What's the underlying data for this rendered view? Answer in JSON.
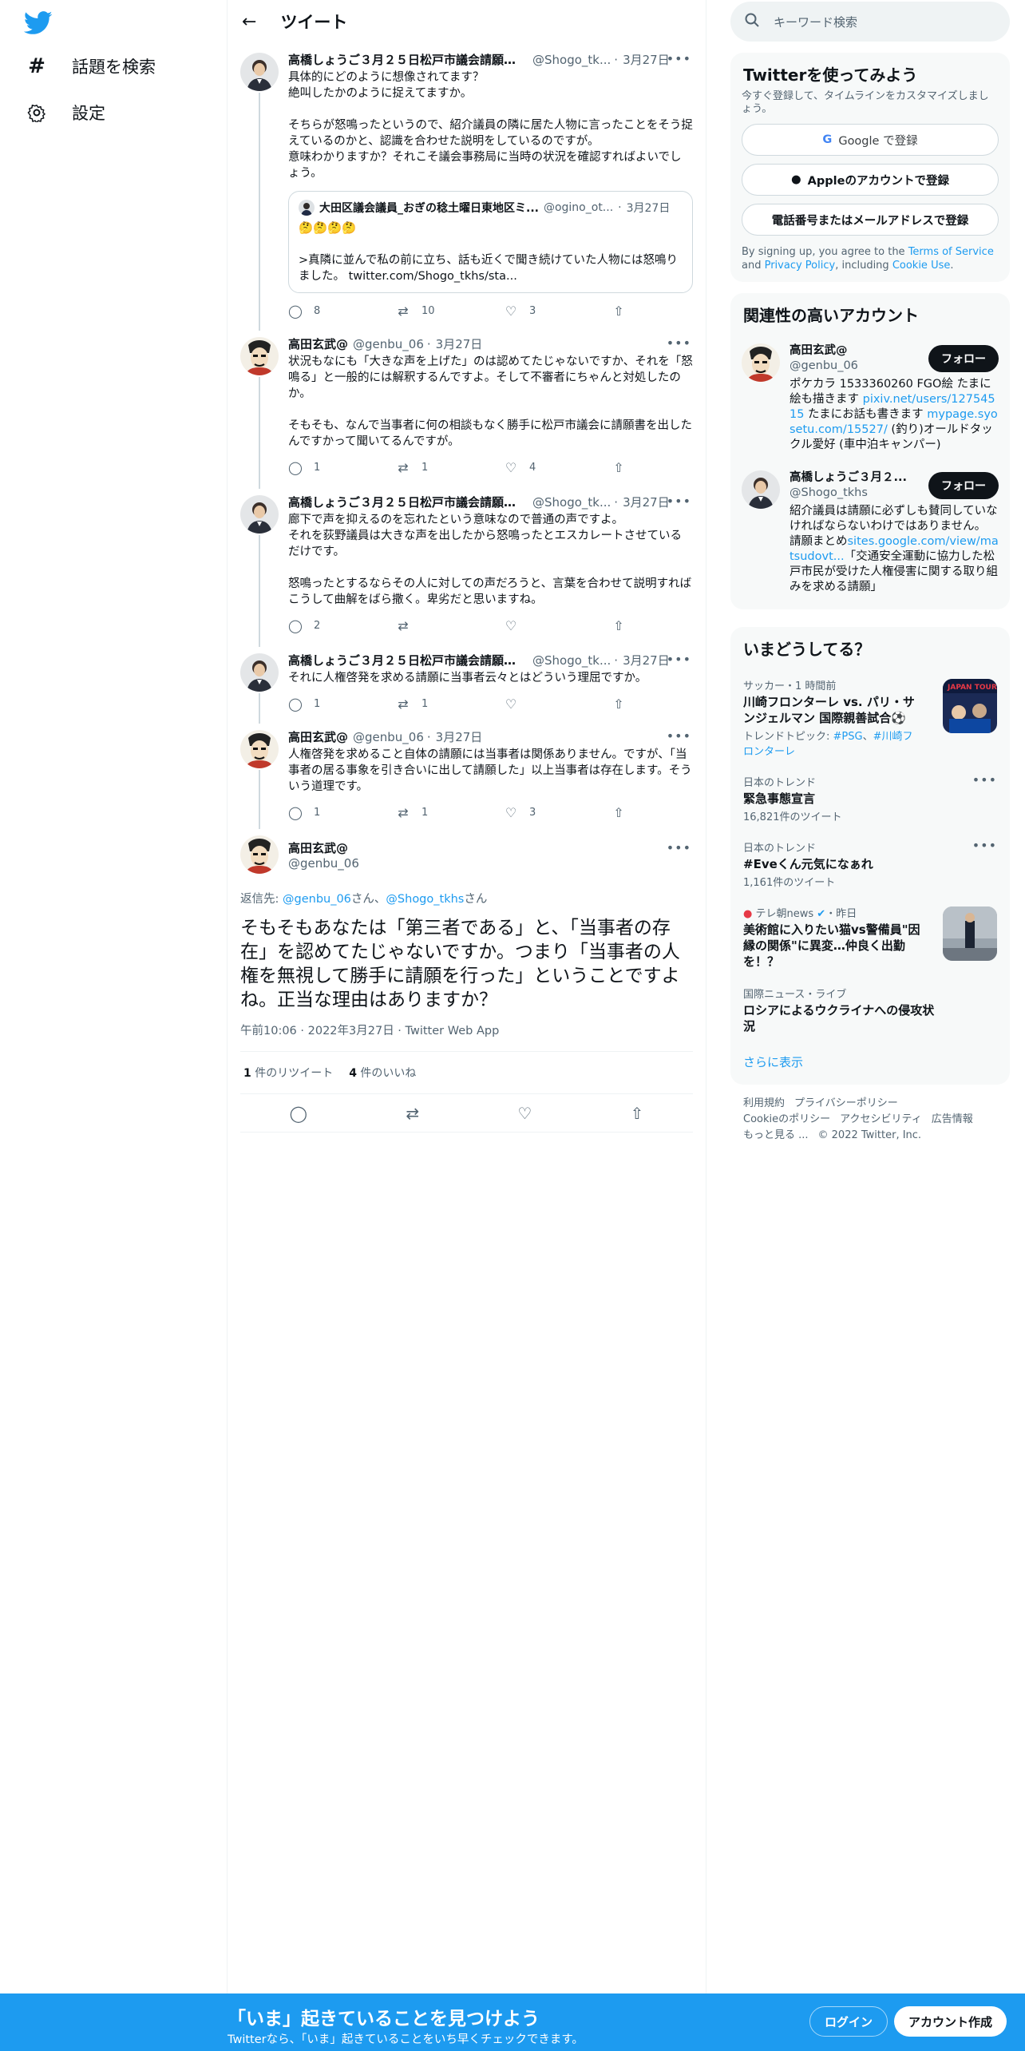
{
  "nav": {
    "items": [
      {
        "label": "話題を検索",
        "icon": "hashtag-icon"
      },
      {
        "label": "設定",
        "icon": "gear-icon"
      }
    ]
  },
  "header": {
    "title": "ツイート"
  },
  "thread": [
    {
      "name": "高橋しょうご３月２５日松戸市議会請願審...",
      "handle": "@Shogo_tk...",
      "date": "3月27日",
      "text": "具体的にどのように想像されてます？\n絶叫したかのように捉えてますか。\n\nそちらが怒鳴ったというので、紹介議員の隣に居た人物に言ったことをそう捉えているのかと、認識を合わせた説明をしているのですが。\n意味わかりますか？それこそ議会事務局に当時の状況を確認すればよいでしょう。",
      "quote": {
        "name": "大田区議会議員_おぎの稔土曜日東地区ミ...",
        "handle": "@ogino_ot...",
        "date": "3月27日",
        "text": "🤔🤔🤔🤔\n\n>真隣に並んで私の前に立ち、話も近くで聞き続けていた人物には怒鳴りました。 twitter.com/Shogo_tkhs/sta..."
      },
      "replies": "8",
      "retweets": "10",
      "likes": "3"
    },
    {
      "name": "高田玄武@",
      "handle": "@genbu_06",
      "date": "3月27日",
      "text": "状況もなにも「大きな声を上げた」のは認めてたじゃないですか、それを「怒鳴る」と一般的には解釈するんですよ。そして不審者にちゃんと対処したのか。\n\nそもそも、なんで当事者に何の相談もなく勝手に松戸市議会に請願書を出したんですかって聞いてるんですが。",
      "replies": "1",
      "retweets": "1",
      "likes": "4"
    },
    {
      "name": "高橋しょうご３月２５日松戸市議会請願審...",
      "handle": "@Shogo_tk...",
      "date": "3月27日",
      "text": "廊下で声を抑えるのを忘れたという意味なので普通の声ですよ。\nそれを荻野議員は大きな声を出したから怒鳴ったとエスカレートさせているだけです。\n\n怒鳴ったとするならその人に対しての声だろうと、言葉を合わせて説明すればこうして曲解をばら撒く。卑劣だと思いますね。",
      "replies": "2",
      "retweets": "",
      "likes": ""
    },
    {
      "name": "高橋しょうご３月２５日松戸市議会請願審...",
      "handle": "@Shogo_tk...",
      "date": "3月27日",
      "text": "それに人権啓発を求める請願に当事者云々とはどういう理屈ですか。",
      "replies": "1",
      "retweets": "1",
      "likes": ""
    },
    {
      "name": "高田玄武@",
      "handle": "@genbu_06",
      "date": "3月27日",
      "text": "人権啓発を求めること自体の請願には当事者は関係ありません。ですが、「当事者の居る事象を引き合いに出して請願した」以上当事者は存在します。そういう道理です。",
      "replies": "1",
      "retweets": "1",
      "likes": "3"
    }
  ],
  "focus": {
    "name": "高田玄武@",
    "handle": "@genbu_06",
    "replying_prefix": "返信先: ",
    "mention1": "@genbu_06",
    "san1": "さん、",
    "mention2": "@Shogo_tkhs",
    "san2": "さん",
    "text": "そもそもあなたは「第三者である」と、「当事者の存在」を認めてたじゃないですか。つまり「当事者の人権を無視して勝手に請願を行った」ということですよね。正当な理由はありますか？",
    "time": "午前10:06",
    "date": "2022年3月27日",
    "client": "Twitter Web App",
    "retweets_count": "1",
    "retweets_label": "件のリツイート",
    "likes_count": "4",
    "likes_label": "件のいいね"
  },
  "search": {
    "placeholder": "キーワード検索"
  },
  "signup": {
    "title": "Twitterを使ってみよう",
    "subtitle": "今すぐ登録して、タイムラインをカスタマイズしましょう。",
    "google": "Google で登録",
    "apple": "Appleのアカウントで登録",
    "phone": "電話番号またはメールアドレスで登録",
    "terms_prefix": "By signing up, you agree to the ",
    "terms_link": "Terms of Service",
    "terms_and": " and ",
    "privacy_link": "Privacy Policy",
    "terms_including": ", including ",
    "cookie_link": "Cookie Use",
    "terms_end": "."
  },
  "related": {
    "title": "関連性の高いアカウント",
    "follow_label": "フォロー",
    "accounts": [
      {
        "name": "高田玄武@",
        "handle": "@genbu_06",
        "bio1": "ポケカラ 1533360260 FGO絵 たまに絵も描きます ",
        "link1": "pixiv.net/users/12754515",
        "bio2": " たまにお話も書きます ",
        "link2": "mypage.syosetu.com/15527/",
        "bio3": " (釣り)オールドタックル愛好 (車中泊キャンパー)"
      },
      {
        "name": "高橋しょうご３月２...",
        "handle": "@Shogo_tkhs",
        "bio1": "紹介議員は請願に必ずしも賛同していなければならないわけではありません。　 請願まとめ",
        "link1": "sites.google.com/view/matsudovt...",
        "bio2": "「交通安全運動に協力した松戸市民が受けた人権侵害に関する取り組みを求める請願」"
      }
    ]
  },
  "trends": {
    "title": "いまどうしてる？",
    "items": [
      {
        "context": "サッカー・1 時間前",
        "title": "川崎フロンターレ vs. パリ・サンジェルマン 国際親善試合⚽",
        "extra_prefix": "トレンドトピック: ",
        "extra_link1": "#PSG",
        "extra_sep": "、",
        "extra_link2": "#川崎フロンターレ"
      },
      {
        "context": "日本のトレンド",
        "title": "緊急事態宣言",
        "count": "16,821件のツイート"
      },
      {
        "context": "日本のトレンド",
        "title": "#Eveくん元気になぁれ",
        "count": "1,161件のツイート"
      },
      {
        "context_src": "テレ朝news",
        "context_time": "・昨日",
        "title": "美術館に入りたい猫vs警備員\"因縁の関係\"に異変…仲良く出勤を！？"
      },
      {
        "context": "国際ニュース・ライブ",
        "title": "ロシアによるウクライナへの侵攻状況"
      }
    ],
    "show_more": "さらに表示"
  },
  "footer": {
    "links": [
      "利用規約",
      "プライバシーポリシー",
      "Cookieのポリシー",
      "アクセシビリティ",
      "広告情報",
      "もっと見る ..."
    ],
    "copyright": "© 2022 Twitter, Inc."
  },
  "bottom": {
    "title": "「いま」起きていることを見つけよう",
    "subtitle": "Twitterなら、「いま」起きていることをいち早くチェックできます。",
    "login": "ログイン",
    "signup": "アカウント作成"
  }
}
